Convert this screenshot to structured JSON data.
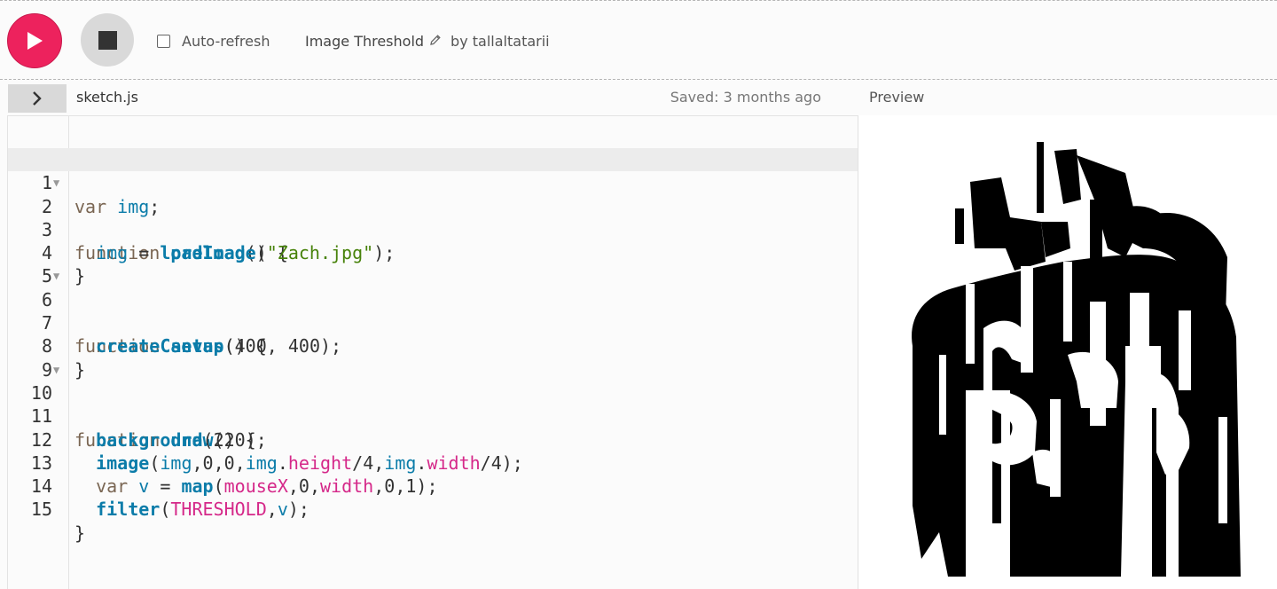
{
  "toolbar": {
    "play_label": "Play",
    "stop_label": "Stop",
    "auto_refresh_label": "Auto-refresh",
    "auto_refresh_checked": false,
    "project_name": "Image Threshold",
    "by_prefix": "by",
    "author": "tallaltatarii",
    "accent_color": "#ed225d"
  },
  "editor": {
    "collapse_icon": "chevron-right-icon",
    "filename": "sketch.js",
    "saved_status": "Saved: 3 months ago",
    "active_line": 1,
    "line_numbers": [
      "1",
      "2",
      "3",
      "4",
      "5",
      "6",
      "7",
      "8",
      "9",
      "10",
      "11",
      "12",
      "13",
      "14",
      "15"
    ],
    "code": [
      "var img;",
      "function preload() {",
      "  img = loadImage(\"Zach.jpg\");",
      "}",
      "",
      "function setup() {",
      "  createCanvas(400, 400);",
      "}",
      "",
      "function draw() {",
      "  background(220);",
      "  image(img,0,0,img.height/4,img.width/4);",
      "  var v = map(mouseX,0,width,0,1);",
      "  filter(THRESHOLD,v);",
      "}"
    ]
  },
  "preview": {
    "label": "Preview"
  }
}
